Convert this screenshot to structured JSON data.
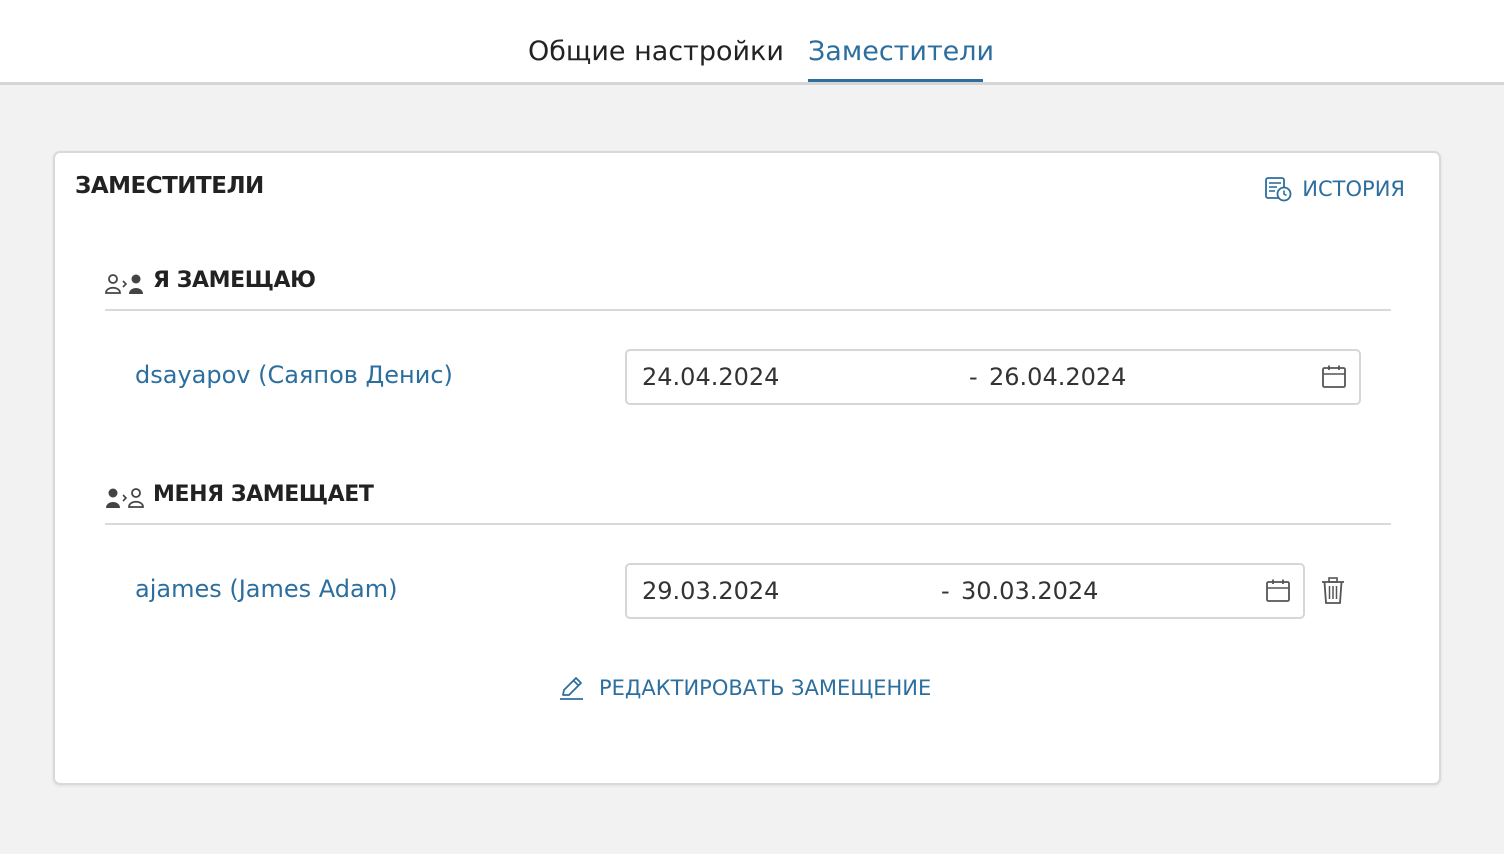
{
  "tabs": [
    {
      "label": "Общие настройки",
      "active": false
    },
    {
      "label": "Заместители",
      "active": true
    }
  ],
  "card": {
    "title": "ЗАМЕСТИТЕЛИ",
    "history_label": "ИСТОРИЯ"
  },
  "sections": [
    {
      "title": "Я ЗАМЕЩАЮ",
      "icon": "user-replace-right-icon",
      "person": "dsayapov (Саяпов Денис)",
      "date_from": "24.04.2024",
      "separator": "-",
      "date_to": "26.04.2024",
      "deletable": false
    },
    {
      "title": "МЕНЯ ЗАМЕЩАЕТ",
      "icon": "user-replace-left-icon",
      "person": "ajames (James Adam)",
      "date_from": "29.03.2024",
      "separator": "-",
      "date_to": "30.03.2024",
      "deletable": true
    }
  ],
  "edit_label": "РЕДАКТИРОВАТЬ ЗАМЕЩЕНИЕ",
  "colors": {
    "accent": "#2c6f9f",
    "text": "#222222",
    "border": "#d9d9d9",
    "background": "#f2f2f2"
  }
}
